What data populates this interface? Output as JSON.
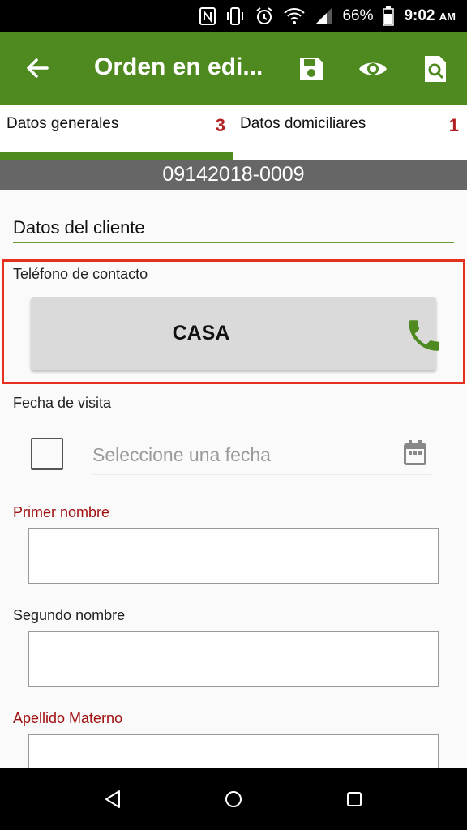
{
  "status_bar": {
    "battery": "66%",
    "time": "9:02",
    "ampm": "AM",
    "icons": [
      "nfc-icon",
      "vibrate-icon",
      "alarm-icon",
      "wifi-icon",
      "signal-icon",
      "battery-icon"
    ]
  },
  "app_bar": {
    "title": "Orden en edi...",
    "background": "#4e8a1f",
    "actions": [
      "save-icon",
      "eye-icon",
      "search-document-icon"
    ]
  },
  "tabs": [
    {
      "label": "Datos generales",
      "count": "3",
      "selected": true
    },
    {
      "label": "Datos domiciliares",
      "count": "1",
      "selected": false
    }
  ],
  "order_number": "09142018-0009",
  "section": {
    "title": "Datos del cliente"
  },
  "contact": {
    "label": "Teléfono de contacto",
    "button_label": "CASA"
  },
  "visit_date": {
    "label": "Fecha de visita",
    "placeholder": "Seleccione una fecha"
  },
  "fields": [
    {
      "label": "Primer nombre",
      "required": true,
      "value": ""
    },
    {
      "label": "Segundo nombre",
      "required": false,
      "value": ""
    },
    {
      "label": "Apellido Materno",
      "required": true,
      "value": ""
    }
  ],
  "colors": {
    "accent": "#4e8a1f",
    "required": "#a01010",
    "highlight": "#e53020",
    "banner": "#666666"
  }
}
